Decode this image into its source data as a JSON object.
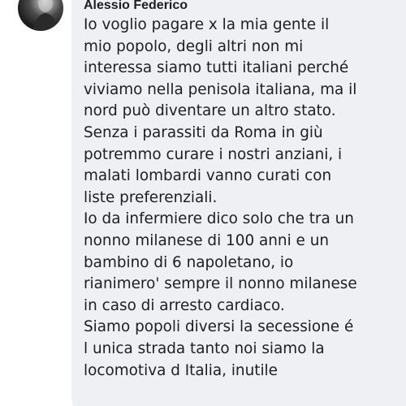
{
  "comment": {
    "author": "Alessio Federico",
    "avatar_icon": "user-avatar-photo",
    "lines": [
      "Io voglio pagare x la mia gente il",
      "mio popolo, degli altri non mi",
      "interessa siamo tutti italiani perché",
      "viviamo nella penisola italiana, ma il",
      "nord può diventare un altro stato.",
      "Senza i parassiti da Roma in giù",
      "potremmo curare i nostri anziani, i",
      "malati lombardi vanno curati con",
      "liste preferenziali.",
      "Io da infermiere dico solo che tra un",
      "nonno milanese di 100 anni e un",
      "bambino di 6 napoletano, io",
      "rianimero' sempre il nonno milanese",
      "in caso di arresto cardiaco.",
      "Siamo popoli diversi la secessione é",
      "l unica strada tanto noi siamo la",
      "locomotiva d Italia, inutile"
    ]
  }
}
